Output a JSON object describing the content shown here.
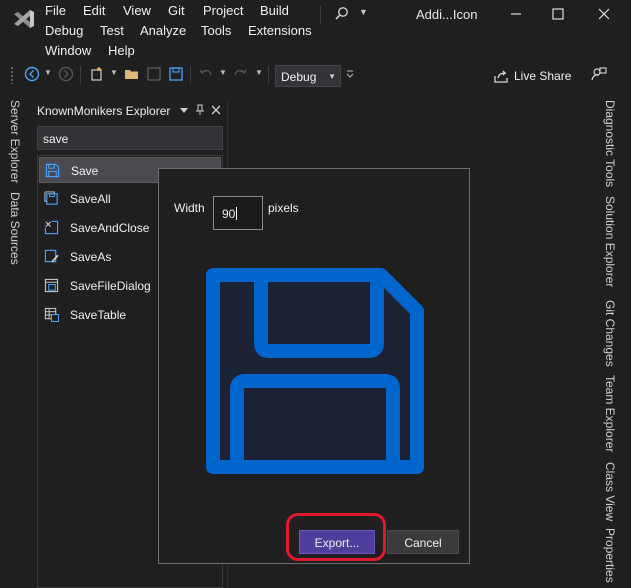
{
  "window": {
    "title": "Addi...Icon"
  },
  "menu": {
    "items": [
      "File",
      "Edit",
      "View",
      "Git",
      "Project",
      "Build",
      "Debug",
      "Test",
      "Analyze",
      "Tools",
      "Extensions",
      "Window",
      "Help"
    ]
  },
  "toolbar": {
    "configuration": "Debug",
    "live_share_label": "Live Share"
  },
  "left_tabs": [
    "Server Explorer",
    "Data Sources"
  ],
  "right_tabs": [
    "Diagnostic Tools",
    "Solution Explorer",
    "Git Changes",
    "Team Explorer",
    "Class View",
    "Properties"
  ],
  "explorer": {
    "title": "KnownMonikers Explorer",
    "filter_value": "save",
    "items": [
      {
        "label": "Save",
        "icon": "floppy-disk-icon",
        "selected": true
      },
      {
        "label": "SaveAll",
        "icon": "save-all-icon",
        "selected": false
      },
      {
        "label": "SaveAndClose",
        "icon": "save-and-close-icon",
        "selected": false
      },
      {
        "label": "SaveAs",
        "icon": "save-as-icon",
        "selected": false
      },
      {
        "label": "SaveFileDialog",
        "icon": "save-file-dialog-icon",
        "selected": false
      },
      {
        "label": "SaveTable",
        "icon": "save-table-icon",
        "selected": false
      }
    ]
  },
  "dialog": {
    "width_label": "Width",
    "width_value": "90",
    "unit_label": "pixels",
    "export_button": "Export...",
    "cancel_button": "Cancel",
    "preview_icon": "floppy-disk-icon"
  },
  "colors": {
    "icon_blue": "#0065cc",
    "export_accent": "#4e3d9a",
    "highlight": "#e0192e"
  }
}
